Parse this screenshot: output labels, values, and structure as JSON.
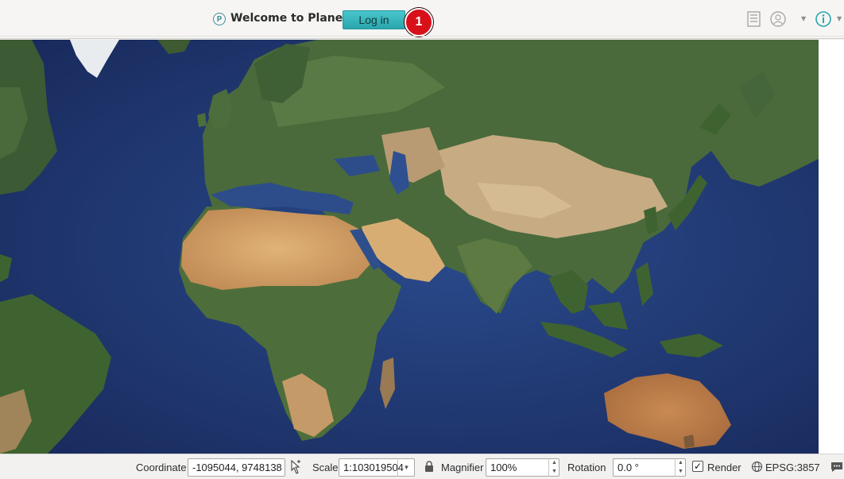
{
  "toolbar": {
    "logo_letter": "p",
    "welcome_text": "Welcome to Planet",
    "login_label": "Log in",
    "step_badge": "1",
    "icons": [
      "planet-logo-icon",
      "layer-list-icon",
      "user-circle-icon",
      "info-icon"
    ]
  },
  "statusbar": {
    "coordinate_label": "Coordinate",
    "coordinate_value": "-1095044, 9748138",
    "scale_label": "Scale",
    "scale_value": "1:103019504",
    "magnifier_label": "Magnifier",
    "magnifier_value": "100%",
    "rotation_label": "Rotation",
    "rotation_value": "0.0 °",
    "render_label": "Render",
    "render_checked": true,
    "crs_label": "EPSG:3857"
  },
  "colors": {
    "accent": "#2fb3ba",
    "badge": "#d8101a",
    "ocean": "#1d356f",
    "toolbar_bg": "#f6f5f4"
  }
}
